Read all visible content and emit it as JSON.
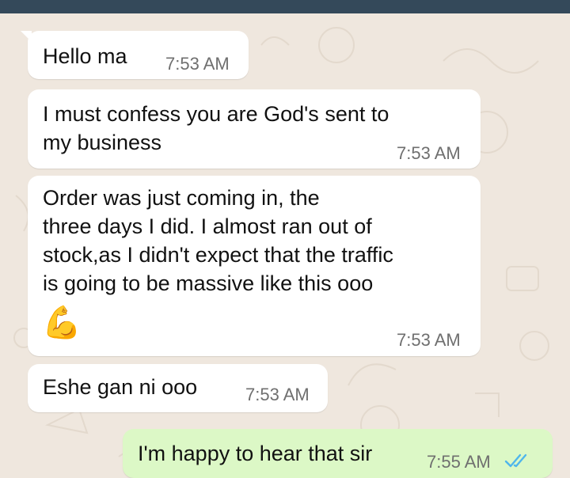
{
  "colors": {
    "wallpaper": "#efe7de",
    "top_bar": "#34495a",
    "incoming_bubble": "#ffffff",
    "outgoing_bubble": "#dcf8c6",
    "read_ticks": "#4fb6ec"
  },
  "messages": [
    {
      "direction": "incoming",
      "text": "Hello ma",
      "time": "7:53 AM"
    },
    {
      "direction": "incoming",
      "text": "I must confess you are God's sent to\nmy business",
      "time": "7:53 AM"
    },
    {
      "direction": "incoming",
      "text": "Order was just coming in, the\nthree days I did. I almost ran out of\nstock,as I didn't expect that the traffic\nis going to be massive like this ooo",
      "emoji": "💪",
      "time": "7:53 AM"
    },
    {
      "direction": "incoming",
      "text": "Eshe gan ni ooo",
      "time": "7:53 AM"
    },
    {
      "direction": "outgoing",
      "text": "I'm happy to hear that sir",
      "time": "7:55 AM",
      "status_icon": "double-check-read-icon"
    }
  ]
}
